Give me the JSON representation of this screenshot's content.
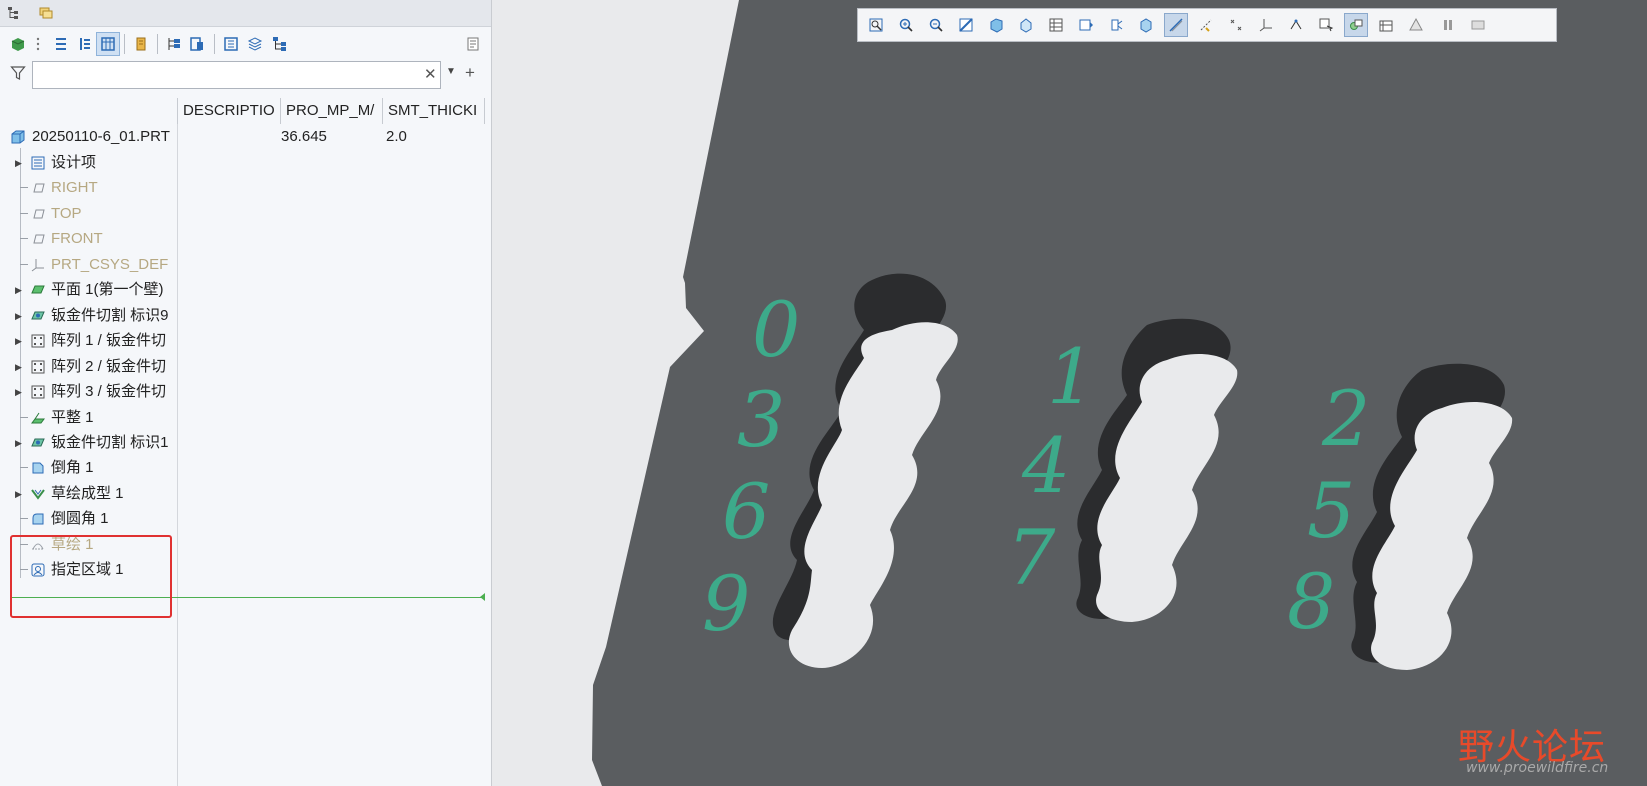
{
  "model_tree": {
    "search": {
      "value": "",
      "placeholder": ""
    },
    "columns": [
      "DESCRIPTIO",
      "PRO_MP_M/",
      "SMT_THICKI"
    ],
    "root": {
      "label": "20250110-6_01.PRT",
      "pro_mp_mass": "36.645",
      "smt_thickness": "2.0"
    },
    "items": [
      {
        "label": "设计项",
        "expandable": true,
        "dim": false,
        "icon": "list-icon"
      },
      {
        "label": "RIGHT",
        "expandable": false,
        "dim": true,
        "icon": "datum-plane-icon"
      },
      {
        "label": "TOP",
        "expandable": false,
        "dim": true,
        "icon": "datum-plane-icon"
      },
      {
        "label": "FRONT",
        "expandable": false,
        "dim": true,
        "icon": "datum-plane-icon"
      },
      {
        "label": "PRT_CSYS_DEF",
        "expandable": false,
        "dim": true,
        "icon": "csys-icon"
      },
      {
        "label": "平面 1(第一个壁)",
        "expandable": true,
        "dim": false,
        "icon": "planar-wall-icon"
      },
      {
        "label": "钣金件切割 标识9",
        "expandable": true,
        "dim": false,
        "icon": "sheetmetal-cut-icon"
      },
      {
        "label": "阵列 1 / 钣金件切",
        "expandable": true,
        "dim": false,
        "icon": "pattern-icon"
      },
      {
        "label": "阵列 2 / 钣金件切",
        "expandable": true,
        "dim": false,
        "icon": "pattern-icon"
      },
      {
        "label": "阵列 3 / 钣金件切",
        "expandable": true,
        "dim": false,
        "icon": "pattern-icon"
      },
      {
        "label": "平整 1",
        "expandable": false,
        "dim": false,
        "icon": "flatten-icon"
      },
      {
        "label": "钣金件切割 标识1",
        "expandable": true,
        "dim": false,
        "icon": "sheetmetal-cut-icon"
      },
      {
        "label": "倒角 1",
        "expandable": false,
        "dim": false,
        "icon": "chamfer-icon"
      },
      {
        "label": "草绘成型 1",
        "expandable": true,
        "dim": false,
        "icon": "sketched-form-icon"
      },
      {
        "label": "倒圆角 1",
        "expandable": false,
        "dim": false,
        "icon": "round-icon"
      },
      {
        "label": "草绘 1",
        "expandable": false,
        "dim": true,
        "icon": "sketch-icon"
      },
      {
        "label": "指定区域 1",
        "expandable": false,
        "dim": false,
        "icon": "designate-area-icon"
      }
    ]
  },
  "viewport": {
    "digits": [
      "0",
      "3",
      "6",
      "9",
      "1",
      "4",
      "7",
      "2",
      "5",
      "8"
    ],
    "part_color": "#5a5d60",
    "digit_color": "#3daa8a",
    "background": "#e9eaec",
    "toolbar_icons": [
      "refit-icon",
      "zoom-in-icon",
      "zoom-out-icon",
      "repaint-icon",
      "display-style-icon",
      "saved-orientations-icon",
      "view-manager-icon",
      "perspective-icon",
      "spin-center-icon",
      "annotation-display-icon",
      "plane-display-icon",
      "axis-display-icon",
      "point-display-icon",
      "csys-display-icon",
      "sketch-display-icon",
      "select-filter-icon",
      "appearance-icon",
      "section-icon",
      "simulation-icon",
      "pause-icon",
      "stop-icon"
    ]
  },
  "watermark": {
    "title": "野火论坛",
    "url": "www.proewildfire.cn"
  }
}
